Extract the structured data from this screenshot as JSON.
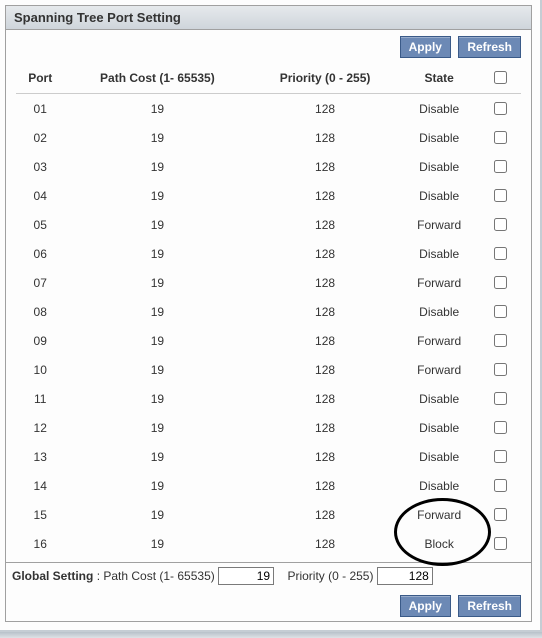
{
  "title": "Spanning Tree Port Setting",
  "buttons": {
    "apply": "Apply",
    "refresh": "Refresh"
  },
  "columns": {
    "port": "Port",
    "pathcost": "Path Cost (1- 65535)",
    "priority": "Priority (0 - 255)",
    "state": "State",
    "check": ""
  },
  "rows": [
    {
      "port": "01",
      "pathcost": "19",
      "priority": "128",
      "state": "Disable"
    },
    {
      "port": "02",
      "pathcost": "19",
      "priority": "128",
      "state": "Disable"
    },
    {
      "port": "03",
      "pathcost": "19",
      "priority": "128",
      "state": "Disable"
    },
    {
      "port": "04",
      "pathcost": "19",
      "priority": "128",
      "state": "Disable"
    },
    {
      "port": "05",
      "pathcost": "19",
      "priority": "128",
      "state": "Forward"
    },
    {
      "port": "06",
      "pathcost": "19",
      "priority": "128",
      "state": "Disable"
    },
    {
      "port": "07",
      "pathcost": "19",
      "priority": "128",
      "state": "Forward"
    },
    {
      "port": "08",
      "pathcost": "19",
      "priority": "128",
      "state": "Disable"
    },
    {
      "port": "09",
      "pathcost": "19",
      "priority": "128",
      "state": "Forward"
    },
    {
      "port": "10",
      "pathcost": "19",
      "priority": "128",
      "state": "Forward"
    },
    {
      "port": "11",
      "pathcost": "19",
      "priority": "128",
      "state": "Disable"
    },
    {
      "port": "12",
      "pathcost": "19",
      "priority": "128",
      "state": "Disable"
    },
    {
      "port": "13",
      "pathcost": "19",
      "priority": "128",
      "state": "Disable"
    },
    {
      "port": "14",
      "pathcost": "19",
      "priority": "128",
      "state": "Disable"
    },
    {
      "port": "15",
      "pathcost": "19",
      "priority": "128",
      "state": "Forward"
    },
    {
      "port": "16",
      "pathcost": "19",
      "priority": "128",
      "state": "Block"
    }
  ],
  "global": {
    "label": "Global Setting",
    "pathcost_label": "Path Cost (1- 65535)",
    "pathcost_value": "19",
    "priority_label": "Priority (0 - 255)",
    "priority_value": "128"
  },
  "annotation": {
    "circled_rows": [
      14,
      15
    ]
  }
}
